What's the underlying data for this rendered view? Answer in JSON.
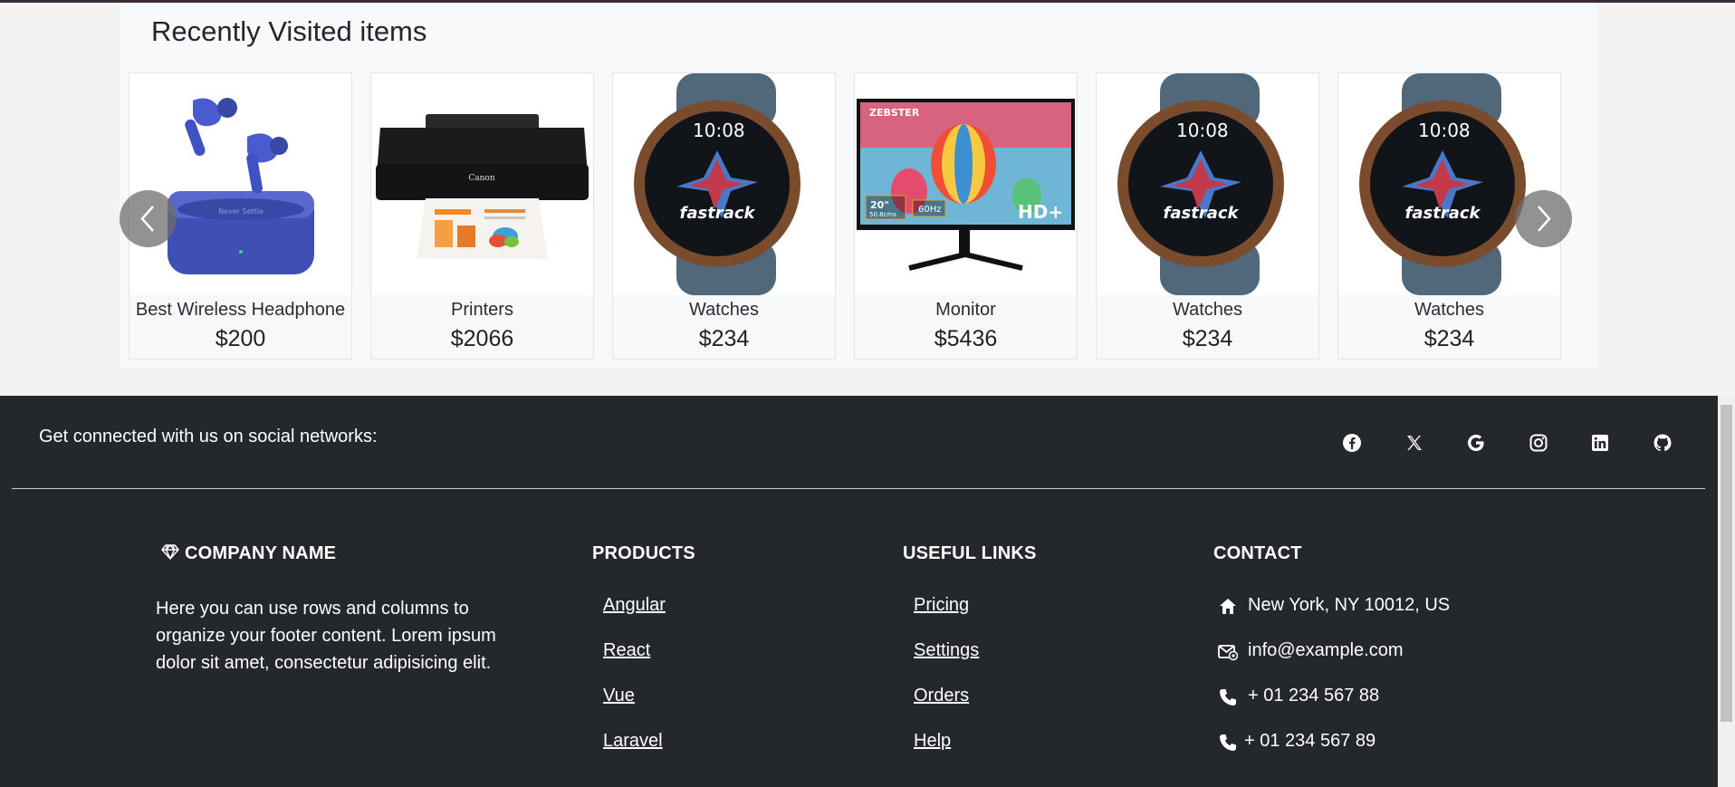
{
  "recent": {
    "title": "Recently Visited items",
    "items": [
      {
        "name": "Best Wireless Headphone",
        "price": "$200",
        "image": "wireless-earbuds-image"
      },
      {
        "name": "Printers",
        "price": "$2066",
        "image": "printer-image"
      },
      {
        "name": "Watches",
        "price": "$234",
        "image": "watch-image"
      },
      {
        "name": "Monitor",
        "price": "$5436",
        "image": "monitor-image"
      },
      {
        "name": "Watches",
        "price": "$234",
        "image": "watch-image"
      },
      {
        "name": "Watches",
        "price": "$234",
        "image": "watch-image"
      }
    ],
    "product_text": {
      "earbuds_brand": "Never Settle",
      "printer_brand": "Canon",
      "watch_time": "10:08",
      "watch_brand": "fastrack",
      "monitor_brand": "ZEBSTER",
      "monitor_size": "20\"",
      "monitor_size_cm": "50.8cms",
      "monitor_refresh": "60Hz",
      "monitor_res": "HD+"
    },
    "prev_icon": "chevron-left-icon",
    "next_icon": "chevron-right-icon"
  },
  "footer": {
    "social_text": "Get connected with us on social networks:",
    "social_icons": [
      "facebook-icon",
      "x-twitter-icon",
      "google-icon",
      "instagram-icon",
      "linkedin-icon",
      "github-icon"
    ],
    "company": {
      "title": "COMPANY NAME",
      "icon": "gem-icon",
      "text": "Here you can use rows and columns to organize your footer content. Lorem ipsum dolor sit amet, consectetur adipisicing elit."
    },
    "products": {
      "title": "PRODUCTS",
      "links": [
        "Angular",
        "React",
        "Vue",
        "Laravel"
      ]
    },
    "useful": {
      "title": "USEFUL LINKS",
      "links": [
        "Pricing",
        "Settings",
        "Orders",
        "Help"
      ]
    },
    "contact": {
      "title": "CONTACT",
      "items": [
        {
          "icon": "home-icon",
          "text": "New York, NY 10012, US"
        },
        {
          "icon": "envelope-icon",
          "text": "info@example.com"
        },
        {
          "icon": "phone-icon",
          "text": "+ 01 234 567 88"
        },
        {
          "icon": "phone-icon",
          "text": "+ 01 234 567 89"
        }
      ]
    }
  },
  "colors": {
    "footer_bg": "#24272b",
    "page_bg": "#f4f2f1",
    "section_bg": "#f8f9fb"
  }
}
